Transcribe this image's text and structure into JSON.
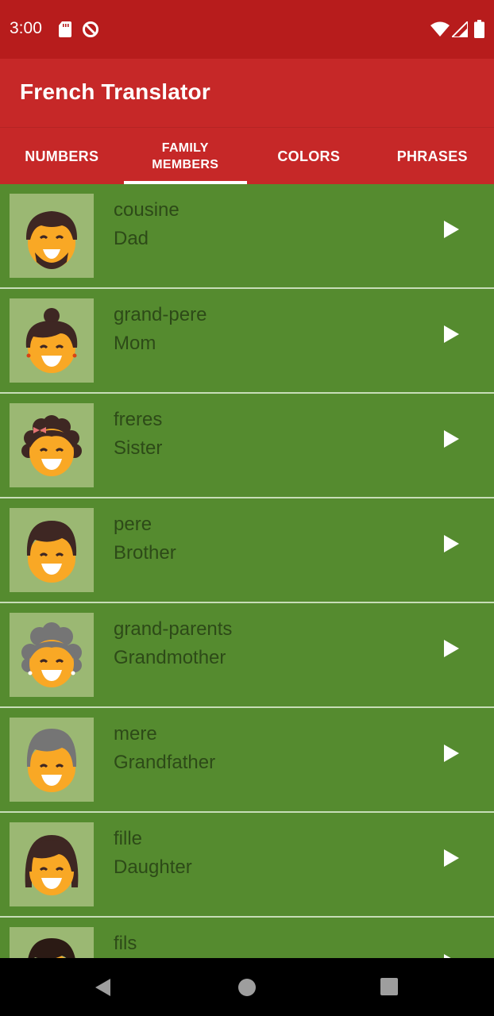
{
  "status_bar": {
    "time": "3:00",
    "icons": [
      "sd-card-icon",
      "sync-disabled-icon",
      "wifi-icon",
      "cell-signal-icon",
      "battery-icon"
    ]
  },
  "app_bar": {
    "title": "French Translator"
  },
  "tabs": [
    {
      "label": "NUMBERS",
      "selected": false
    },
    {
      "label": "FAMILY MEMBERS",
      "selected": true
    },
    {
      "label": "COLORS",
      "selected": false
    },
    {
      "label": "PHRASES",
      "selected": false
    }
  ],
  "list": {
    "items": [
      {
        "french": "cousine",
        "english": "Dad",
        "icon": "father-avatar-icon"
      },
      {
        "french": "grand-pere",
        "english": "Mom",
        "icon": "mother-avatar-icon"
      },
      {
        "french": "freres",
        "english": "Sister",
        "icon": "sister-avatar-icon"
      },
      {
        "french": "pere",
        "english": "Brother",
        "icon": "brother-avatar-icon"
      },
      {
        "french": "grand-parents",
        "english": "Grandmother",
        "icon": "grandmother-avatar-icon"
      },
      {
        "french": "mere",
        "english": "Grandfather",
        "icon": "grandfather-avatar-icon"
      },
      {
        "french": "fille",
        "english": "Daughter",
        "icon": "daughter-avatar-icon"
      },
      {
        "french": "fils",
        "english": "",
        "icon": "son-avatar-icon"
      }
    ]
  },
  "colors": {
    "status_bar": "#b71c1c",
    "app_bar": "#c62828",
    "list_background": "#558b2f",
    "thumbnail_background": "#9bb873",
    "text": "#2d4a18"
  },
  "nav_bar": {
    "icons": [
      "back-icon",
      "home-icon",
      "recents-icon"
    ]
  }
}
